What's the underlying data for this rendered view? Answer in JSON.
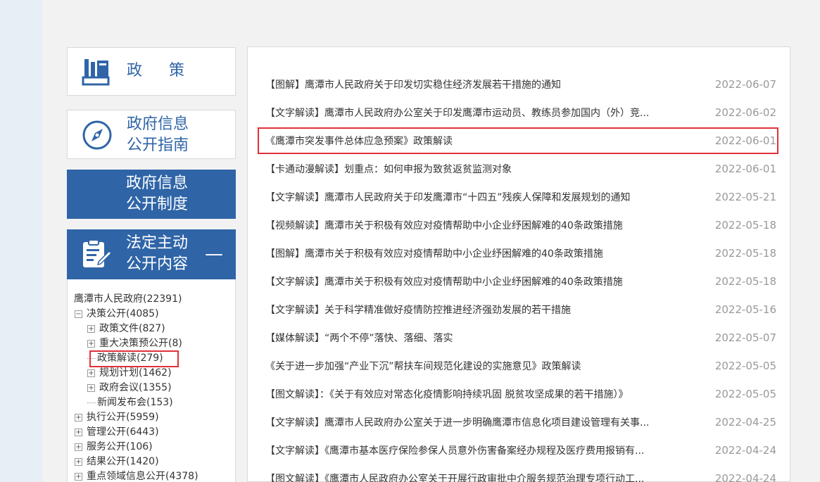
{
  "sidebar": {
    "policy_title": "政策",
    "guide_title_1": "政府信息",
    "guide_title_2": "公开指南",
    "system_title_1": "政府信息",
    "system_title_2": "公开制度",
    "legal_title_1": "法定主动",
    "legal_title_2": "公开内容",
    "collapse_symbol": "—",
    "tree": [
      {
        "label": "鹰潭市人民政府(22391)",
        "level": 0,
        "toggle": ""
      },
      {
        "label": "决策公开(4085)",
        "level": 1,
        "toggle": "−"
      },
      {
        "label": "政策文件(827)",
        "level": 2,
        "toggle": "+"
      },
      {
        "label": "重大决策预公开(8)",
        "level": 2,
        "toggle": "+"
      },
      {
        "label": "政策解读(279)",
        "level": 2,
        "toggle": ""
      },
      {
        "label": "规划计划(1462)",
        "level": 2,
        "toggle": "+"
      },
      {
        "label": "政府会议(1355)",
        "level": 2,
        "toggle": "+"
      },
      {
        "label": "新闻发布会(153)",
        "level": 2,
        "toggle": ""
      },
      {
        "label": "执行公开(5959)",
        "level": 1,
        "toggle": "+"
      },
      {
        "label": "管理公开(6443)",
        "level": 1,
        "toggle": "+"
      },
      {
        "label": "服务公开(106)",
        "level": 1,
        "toggle": "+"
      },
      {
        "label": "结果公开(1420)",
        "level": 1,
        "toggle": "+"
      },
      {
        "label": "重点领域信息公开(4378)",
        "level": 1,
        "toggle": "+"
      }
    ]
  },
  "list": [
    {
      "title": "【图解】鹰潭市人民政府关于印发切实稳住经济发展若干措施的通知",
      "date": "2022-06-07"
    },
    {
      "title": "【文字解读】鹰潭市人民政府办公室关于印发鹰潭市运动员、教练员参加国内（外）竞...",
      "date": "2022-06-02"
    },
    {
      "title": "《鹰潭市突发事件总体应急预案》政策解读",
      "date": "2022-06-01"
    },
    {
      "title": "【卡通动漫解读】划重点：如何申报为致贫返贫监测对象",
      "date": "2022-06-01"
    },
    {
      "title": "【文字解读】鹰潭市人民政府关于印发鹰潭市“十四五”残疾人保障和发展规划的通知",
      "date": "2022-05-21"
    },
    {
      "title": "【视频解读】鹰潭市关于积极有效应对疫情帮助中小企业纾困解难的40条政策措施",
      "date": "2022-05-18"
    },
    {
      "title": "【图解】鹰潭市关于积极有效应对疫情帮助中小企业纾困解难的40条政策措施",
      "date": "2022-05-18"
    },
    {
      "title": "【文字解读】鹰潭市关于积极有效应对疫情帮助中小企业纾困解难的40条政策措施",
      "date": "2022-05-18"
    },
    {
      "title": "【文字解读】关于科学精准做好疫情防控推进经济强劲发展的若干措施",
      "date": "2022-05-16"
    },
    {
      "title": "【媒体解读】“两个不停”落快、落细、落实",
      "date": "2022-05-07"
    },
    {
      "title": "《关于进一步加强“产业下沉”帮扶车间规范化建设的实施意见》政策解读",
      "date": "2022-05-05"
    },
    {
      "title": "【图文解读】：《关于有效应对常态化疫情影响持续巩固 脱贫攻坚成果的若干措施）》",
      "date": "2022-05-05"
    },
    {
      "title": "【文字解读】鹰潭市人民政府办公室关于进一步明确鹰潭市信息化项目建设管理有关事...",
      "date": "2022-04-25"
    },
    {
      "title": "【文字解读】《鹰潭市基本医疗保险参保人员意外伤害备案经办规程及医疗费用报销有...",
      "date": "2022-04-24"
    },
    {
      "title": "【图文解读】《鹰潭市人民政府办公室关于开展行政审批中介服务规范治理专项行动工...",
      "date": "2022-04-24"
    }
  ],
  "colors": {
    "accent_blue": "#2f65a7",
    "highlight_red": "#e0323a"
  }
}
